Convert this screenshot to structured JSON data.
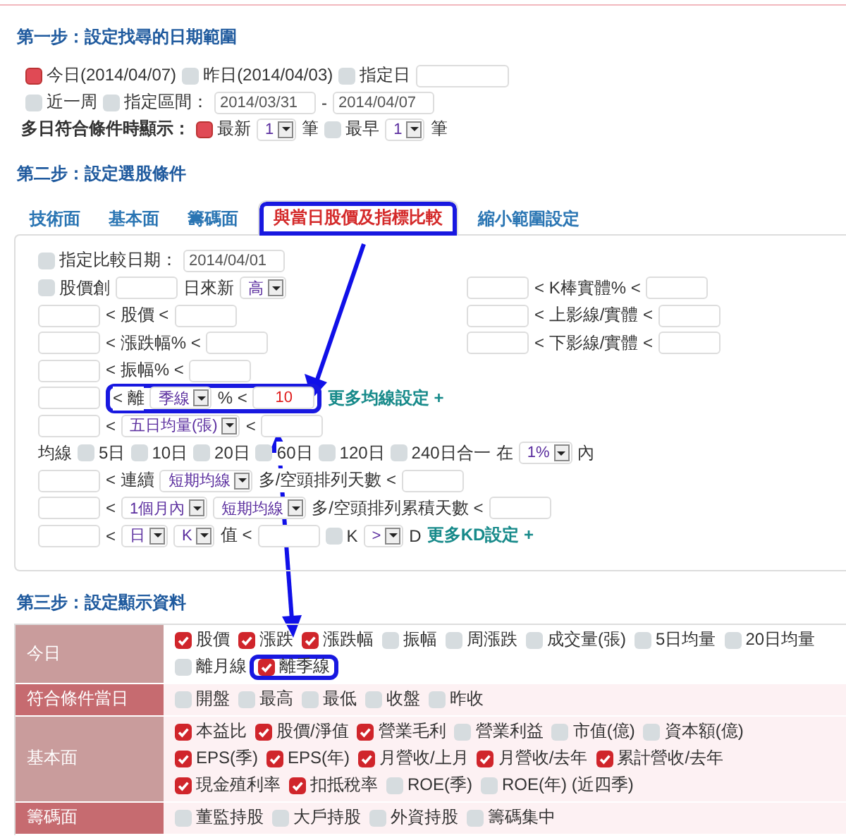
{
  "step1": {
    "heading": "第一步：設定找尋的日期範圍",
    "rows": [
      {
        "items": [
          {
            "kind": "radio",
            "label": "今日(2014/04/07)",
            "selected": true
          },
          {
            "kind": "radio",
            "label": "昨日(2014/04/03)",
            "selected": false
          },
          {
            "kind": "radio",
            "label": "指定日",
            "selected": false
          },
          {
            "kind": "input"
          }
        ]
      },
      {
        "items": [
          {
            "kind": "radio",
            "label": "近一周",
            "selected": false
          },
          {
            "kind": "radio",
            "label": "指定區間：",
            "selected": false
          },
          {
            "kind": "input",
            "value": "2014/03/31"
          },
          {
            "kind": "text",
            "text": "-"
          },
          {
            "kind": "input",
            "value": "2014/04/07"
          }
        ]
      },
      {
        "items": [
          {
            "kind": "label",
            "text": "多日符合條件時顯示："
          },
          {
            "kind": "radio",
            "label": "最新",
            "selected": true
          },
          {
            "kind": "select",
            "value": "1"
          },
          {
            "kind": "text",
            "text": "筆"
          },
          {
            "kind": "radio",
            "label": "最早",
            "selected": false
          },
          {
            "kind": "select",
            "value": "1"
          },
          {
            "kind": "text",
            "text": "筆"
          }
        ]
      }
    ]
  },
  "step2": {
    "heading": "第二步：設定選股條件",
    "tabs": [
      {
        "label": "技術面",
        "selected": false,
        "annotated": false
      },
      {
        "label": "基本面",
        "selected": false,
        "annotated": false
      },
      {
        "label": "籌碼面",
        "selected": false,
        "annotated": false
      },
      {
        "label": "與當日股價及指標比較",
        "selected": true,
        "annotated": true
      },
      {
        "label": "縮小範圍設定",
        "selected": false,
        "annotated": false
      }
    ],
    "rows": [
      {
        "left": [
          {
            "kind": "checkbox",
            "label": "指定比較日期：",
            "checked": false
          },
          {
            "kind": "input",
            "value": "2014/04/01"
          }
        ]
      },
      {
        "left": [
          {
            "kind": "checkbox",
            "label": "股價創",
            "checked": false
          },
          {
            "kind": "input"
          },
          {
            "kind": "text",
            "text": "日來新"
          },
          {
            "kind": "select",
            "value": "高"
          }
        ],
        "right": [
          {
            "kind": "input"
          },
          {
            "kind": "text",
            "text": "< K棒實體% <"
          },
          {
            "kind": "input"
          }
        ]
      },
      {
        "left": [
          {
            "kind": "input"
          },
          {
            "kind": "text",
            "text": "< 股價 <"
          },
          {
            "kind": "input"
          }
        ],
        "right": [
          {
            "kind": "input"
          },
          {
            "kind": "text",
            "text": "< 上影線/實體 <"
          },
          {
            "kind": "input"
          }
        ]
      },
      {
        "left": [
          {
            "kind": "input"
          },
          {
            "kind": "text",
            "text": "< 漲跌幅% <"
          },
          {
            "kind": "input"
          }
        ],
        "right": [
          {
            "kind": "input"
          },
          {
            "kind": "text",
            "text": "< 下影線/實體 <"
          },
          {
            "kind": "input"
          }
        ]
      },
      {
        "left": [
          {
            "kind": "input"
          },
          {
            "kind": "text",
            "text": "< 振幅% <"
          },
          {
            "kind": "input"
          }
        ]
      },
      {
        "left": [
          {
            "kind": "input"
          },
          {
            "kind": "group",
            "annotated": true,
            "items": [
              {
                "kind": "text",
                "text": "< 離"
              },
              {
                "kind": "select",
                "value": "季線"
              },
              {
                "kind": "text",
                "text": "% <"
              },
              {
                "kind": "input",
                "value": "10",
                "highlight": true
              }
            ]
          },
          {
            "kind": "link",
            "text": "更多均線設定 +"
          }
        ]
      },
      {
        "left": [
          {
            "kind": "input"
          },
          {
            "kind": "text",
            "text": "<"
          },
          {
            "kind": "select",
            "value": "五日均量(張)"
          },
          {
            "kind": "text",
            "text": "<"
          },
          {
            "kind": "input"
          }
        ]
      },
      {
        "left": [
          {
            "kind": "text",
            "text": "均線"
          },
          {
            "kind": "checkbox",
            "label": "5日",
            "checked": false
          },
          {
            "kind": "checkbox",
            "label": "10日",
            "checked": false
          },
          {
            "kind": "checkbox",
            "label": "20日",
            "checked": false
          },
          {
            "kind": "checkbox",
            "label": "60日",
            "checked": false
          },
          {
            "kind": "checkbox",
            "label": "120日",
            "checked": false
          },
          {
            "kind": "checkbox",
            "label": "240日合一",
            "checked": false
          },
          {
            "kind": "text",
            "text": "在"
          },
          {
            "kind": "select",
            "value": "1%"
          },
          {
            "kind": "text",
            "text": "內"
          }
        ]
      },
      {
        "left": [
          {
            "kind": "input"
          },
          {
            "kind": "text",
            "text": "< 連續"
          },
          {
            "kind": "select",
            "value": "短期均線"
          },
          {
            "kind": "text",
            "text": "多/空頭排列天數 <"
          },
          {
            "kind": "input"
          }
        ]
      },
      {
        "left": [
          {
            "kind": "input"
          },
          {
            "kind": "text",
            "text": "<"
          },
          {
            "kind": "select",
            "value": "1個月內"
          },
          {
            "kind": "select",
            "value": "短期均線"
          },
          {
            "kind": "text",
            "text": "多/空頭排列累積天數 <"
          },
          {
            "kind": "input"
          }
        ]
      },
      {
        "left": [
          {
            "kind": "input"
          },
          {
            "kind": "text",
            "text": "<"
          },
          {
            "kind": "select",
            "value": "日"
          },
          {
            "kind": "select",
            "value": "K"
          },
          {
            "kind": "text",
            "text": "值 <"
          },
          {
            "kind": "input"
          },
          {
            "kind": "checkbox",
            "label": "K",
            "checked": false
          },
          {
            "kind": "select",
            "value": ">"
          },
          {
            "kind": "text",
            "text": "D"
          },
          {
            "kind": "link",
            "text": "更多KD設定 +"
          }
        ]
      }
    ]
  },
  "step3": {
    "heading": "第三步：設定顯示資料",
    "rows": [
      {
        "label": "今日",
        "options": [
          {
            "label": "股價",
            "checked": true,
            "annotated": false
          },
          {
            "label": "漲跌",
            "checked": true,
            "annotated": false
          },
          {
            "label": "漲跌幅",
            "checked": true,
            "annotated": false
          },
          {
            "label": "振幅",
            "checked": false,
            "annotated": false
          },
          {
            "label": "周漲跌",
            "checked": false,
            "annotated": false
          },
          {
            "label": "成交量(張)",
            "checked": false,
            "annotated": false
          },
          {
            "label": "5日均量",
            "checked": false,
            "annotated": false
          },
          {
            "label": "20日均量",
            "checked": false,
            "annotated": false
          },
          {
            "label": "離月線",
            "checked": false,
            "annotated": false
          },
          {
            "label": "離季線",
            "checked": true,
            "annotated": true
          }
        ]
      },
      {
        "label": "符合條件當日",
        "options": [
          {
            "label": "開盤",
            "checked": false
          },
          {
            "label": "最高",
            "checked": false
          },
          {
            "label": "最低",
            "checked": false
          },
          {
            "label": "收盤",
            "checked": false
          },
          {
            "label": "昨收",
            "checked": false
          }
        ]
      },
      {
        "label": "基本面",
        "options": [
          {
            "label": "本益比",
            "checked": true
          },
          {
            "label": "股價/淨值",
            "checked": true
          },
          {
            "label": "營業毛利",
            "checked": true
          },
          {
            "label": "營業利益",
            "checked": false
          },
          {
            "label": "市值(億)",
            "checked": false
          },
          {
            "label": "資本額(億)",
            "checked": false
          },
          {
            "label": "EPS(季)",
            "checked": true
          },
          {
            "label": "EPS(年)",
            "checked": true
          },
          {
            "label": "月營收/上月",
            "checked": true
          },
          {
            "label": "月營收/去年",
            "checked": true
          },
          {
            "label": "累計營收/去年",
            "checked": true
          },
          {
            "label": "現金殖利率",
            "checked": true
          },
          {
            "label": "扣抵稅率",
            "checked": true
          },
          {
            "label": "ROE(季)",
            "checked": false
          },
          {
            "label": "ROE(年) (近四季)",
            "checked": false
          }
        ]
      },
      {
        "label": "籌碼面",
        "options": [
          {
            "label": "董監持股",
            "checked": false
          },
          {
            "label": "大戶持股",
            "checked": false
          },
          {
            "label": "外資持股",
            "checked": false
          },
          {
            "label": "籌碼集中",
            "checked": false
          }
        ]
      }
    ]
  }
}
